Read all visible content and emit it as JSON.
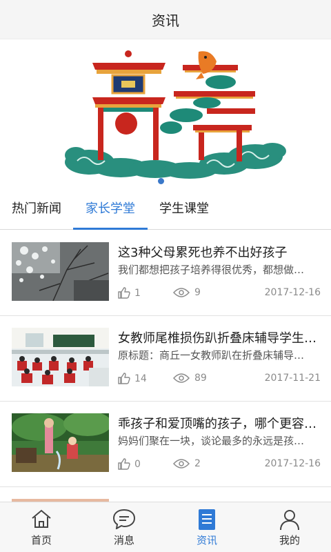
{
  "header": {
    "title": "资讯"
  },
  "tabs": [
    {
      "label": "热门新闻",
      "active": false
    },
    {
      "label": "家长学堂",
      "active": true
    },
    {
      "label": "学生课堂",
      "active": false
    }
  ],
  "articles": [
    {
      "title": "这3种父母累死也养不出好孩子",
      "summary": "我们都想把孩子培养得很优秀，都想做…",
      "likes": "1",
      "views": "9",
      "date": "2017-12-16"
    },
    {
      "title": "女教师尾椎损伤趴折叠床辅导学生…",
      "summary": "原标题：商丘一女教师趴在折叠床辅导…",
      "likes": "14",
      "views": "89",
      "date": "2017-11-21"
    },
    {
      "title": "乖孩子和爱顶嘴的孩子，哪个更容…",
      "summary": "妈妈们聚在一块，谈论最多的永远是孩…",
      "likes": "0",
      "views": "2",
      "date": "2017-12-16"
    }
  ],
  "bottom_nav": [
    {
      "label": "首页",
      "icon": "home-icon",
      "active": false
    },
    {
      "label": "消息",
      "icon": "message-icon",
      "active": false
    },
    {
      "label": "资讯",
      "icon": "news-icon",
      "active": true
    },
    {
      "label": "我的",
      "icon": "user-icon",
      "active": false
    }
  ],
  "colors": {
    "accent": "#2f7ad6",
    "text": "#1e1e1e",
    "muted": "#8a8a8a"
  }
}
